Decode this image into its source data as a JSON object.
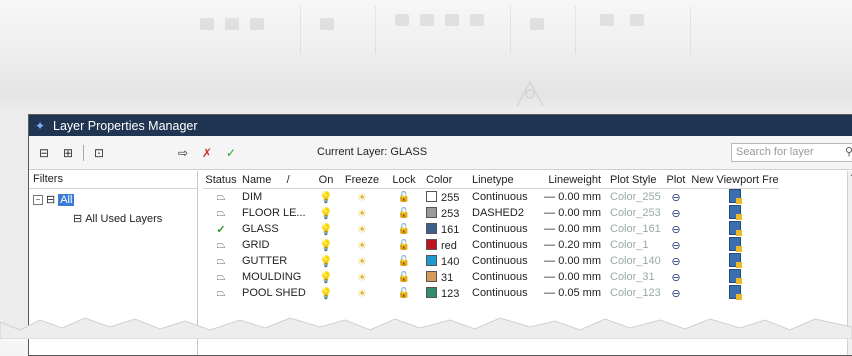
{
  "window": {
    "title": "Layer Properties Manager"
  },
  "toolbar": {
    "current_layer_label": "Current Layer: GLASS",
    "search_placeholder": "Search for layer"
  },
  "filters": {
    "header": "Filters",
    "root": "All",
    "child": "All Used Layers"
  },
  "columns": [
    "Status",
    "Name",
    "/",
    "On",
    "Freeze",
    "Lock",
    "Color",
    "Linetype",
    "Lineweight",
    "Plot Style",
    "Plot",
    "New Viewport Fre"
  ],
  "layers": [
    {
      "status": "",
      "name": "DIM",
      "color_num": "255",
      "color_hex": "#ffffff",
      "linetype": "Continuous",
      "lineweight": "0.00 mm",
      "plot_style": "Color_255"
    },
    {
      "status": "",
      "name": "FLOOR LE...",
      "color_num": "253",
      "color_hex": "#9a9a9a",
      "linetype": "DASHED2",
      "lineweight": "0.00 mm",
      "plot_style": "Color_253"
    },
    {
      "status": "current",
      "name": "GLASS",
      "color_num": "161",
      "color_hex": "#3d5f8c",
      "linetype": "Continuous",
      "lineweight": "0.00 mm",
      "plot_style": "Color_161"
    },
    {
      "status": "",
      "name": "GRID",
      "color_num": "red",
      "color_hex": "#c0141e",
      "linetype": "Continuous",
      "lineweight": "0.20 mm",
      "plot_style": "Color_1"
    },
    {
      "status": "",
      "name": "GUTTER",
      "color_num": "140",
      "color_hex": "#1e9ad1",
      "linetype": "Continuous",
      "lineweight": "0.00 mm",
      "plot_style": "Color_140"
    },
    {
      "status": "",
      "name": "MOULDING",
      "color_num": "31",
      "color_hex": "#d79a5d",
      "linetype": "Continuous",
      "lineweight": "0.00 mm",
      "plot_style": "Color_31"
    },
    {
      "status": "",
      "name": "POOL SHED",
      "color_num": "123",
      "color_hex": "#2f8f6e",
      "linetype": "Continuous",
      "lineweight": "0.05 mm",
      "plot_style": "Color_123"
    }
  ],
  "icons": {
    "app": "layer-manager-icon",
    "on": "lightbulb-icon",
    "freeze": "sun-icon",
    "lock": "unlock-icon",
    "plot": "printer-icon",
    "nvf": "viewport-freeze-icon"
  }
}
